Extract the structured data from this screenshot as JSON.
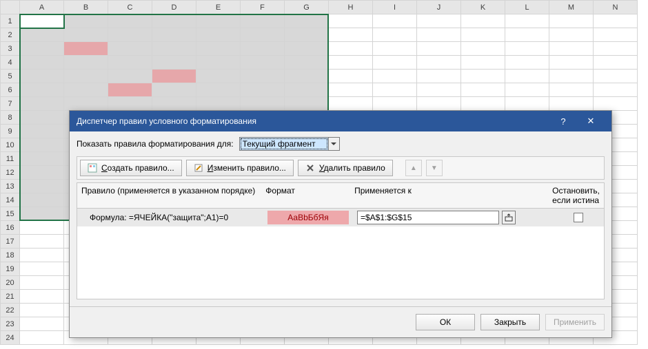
{
  "sheet": {
    "columns": [
      "A",
      "B",
      "C",
      "D",
      "E",
      "F",
      "G",
      "H",
      "I",
      "J",
      "K",
      "L",
      "M",
      "N"
    ],
    "row_count": 24,
    "selection": {
      "from": "A1",
      "to": "G15"
    },
    "active_cell": "A1",
    "highlighted_cells": [
      "B3",
      "C6",
      "D5"
    ]
  },
  "dialog": {
    "title": "Диспетчер правил условного форматирования",
    "help_icon": "?",
    "close_icon": "✕",
    "show_rules_label": "Показать правила форматирования для:",
    "scope_value": "Текущий фрагмент",
    "toolbar": {
      "new_rule": "Создать правило...",
      "edit_rule": "Изменить правило...",
      "delete_rule": "Удалить правило",
      "new_key": "С",
      "edit_key": "И",
      "del_key": "У"
    },
    "headers": {
      "rule": "Правило (применяется в указанном порядке)",
      "format": "Формат",
      "applies_to": "Применяется к",
      "stop_if_true": "Остановить, если истина"
    },
    "rule": {
      "description": "Формула: =ЯЧЕЙКА(\"защита\";A1)=0",
      "preview_text": "АаBbБбЯя",
      "applies_to_value": "=$A$1:$G$15",
      "stop": false
    },
    "footer": {
      "ok": "ОК",
      "close": "Закрыть",
      "apply": "Применить"
    }
  }
}
